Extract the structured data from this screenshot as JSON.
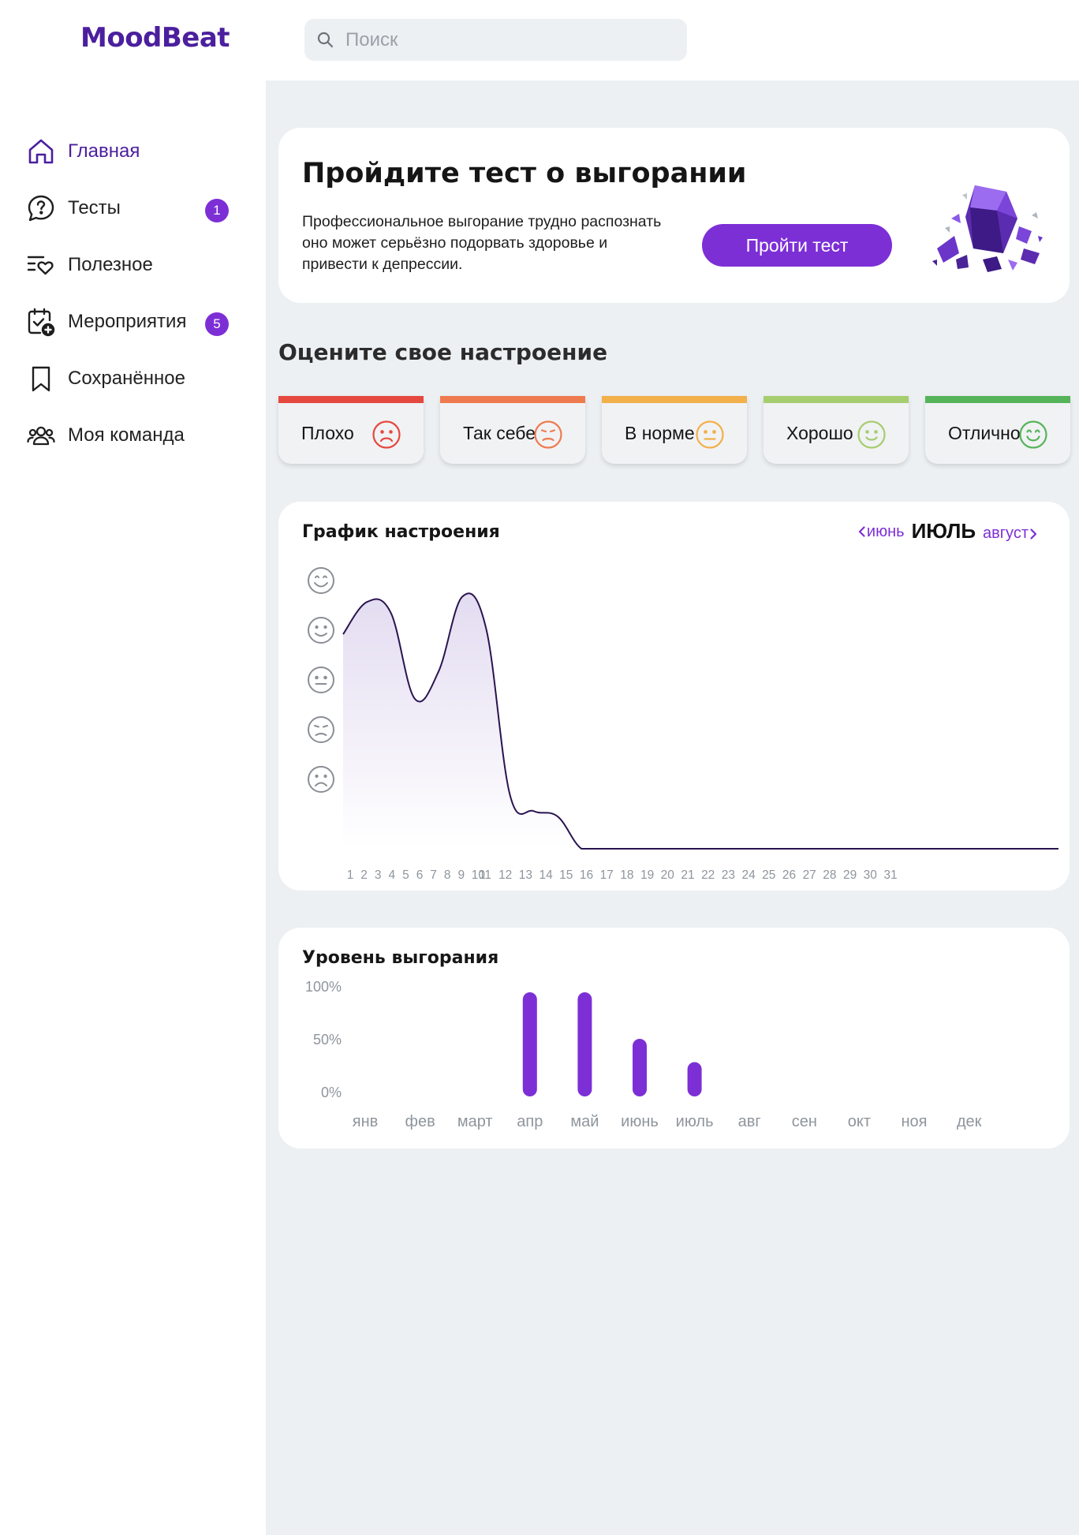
{
  "app": {
    "name": "MoodBeat"
  },
  "search": {
    "placeholder": "Поиск"
  },
  "sidebar": {
    "items": [
      {
        "label": "Главная",
        "icon": "home-icon",
        "active": true
      },
      {
        "label": "Тесты",
        "icon": "question-bubble-icon",
        "badge": "1"
      },
      {
        "label": "Полезное",
        "icon": "list-heart-icon"
      },
      {
        "label": "Мероприятия",
        "icon": "calendar-plus-icon",
        "badge": "5"
      },
      {
        "label": "Сохранённое",
        "icon": "bookmark-icon"
      },
      {
        "label": "Моя команда",
        "icon": "team-icon"
      }
    ]
  },
  "promo": {
    "title": "Пройдите тест о выгорании",
    "text": "Профессиональное выгорание трудно распознать оно может серьёзно подорвать здоровье и привести к депрессии.",
    "button": "Пройти тест"
  },
  "rate": {
    "title": "Оцените свое настроение",
    "moods": [
      {
        "label": "Плохо",
        "color": "#e5483f",
        "face": "sad"
      },
      {
        "label": "Так себе",
        "color": "#ee7b4f",
        "face": "meh-sad"
      },
      {
        "label": "В норме",
        "color": "#f2b04b",
        "face": "neutral"
      },
      {
        "label": "Хорошо",
        "color": "#a6cd6f",
        "face": "smile"
      },
      {
        "label": "Отлично",
        "color": "#55b45a",
        "face": "big-smile"
      }
    ]
  },
  "colors": {
    "accent": "#7d2fd6",
    "brand": "#4b1f9e",
    "background": "#ecf0f3"
  },
  "mood_chart": {
    "title": "График настроения",
    "prev_month": "июнь",
    "current_month": "ИЮЛЬ",
    "next_month": "август"
  },
  "burnout_chart": {
    "title": "Уровень выгорания"
  },
  "chart_data": [
    {
      "type": "area",
      "title": "График настроения",
      "x": [
        1,
        2,
        3,
        4,
        5,
        6,
        7,
        8,
        9,
        10,
        11,
        12,
        13,
        14,
        15,
        16,
        17,
        18,
        19,
        20,
        21,
        22,
        23,
        24,
        25,
        26,
        27,
        28,
        29,
        30,
        31
      ],
      "y_levels": [
        "sad",
        "meh-sad",
        "neutral",
        "smile",
        "big-smile"
      ],
      "ylim": [
        0,
        5
      ],
      "values": [
        4.0,
        4.6,
        4.4,
        2.8,
        3.3,
        4.7,
        4.1,
        1.0,
        0.7,
        0.6,
        0,
        0,
        0,
        0,
        0,
        0,
        0,
        0,
        0,
        0,
        0,
        0,
        0,
        0,
        0,
        0,
        0,
        0,
        0,
        0,
        0
      ],
      "grid": false
    },
    {
      "type": "bar",
      "title": "Уровень выгорания",
      "categories": [
        "янв",
        "фев",
        "март",
        "апр",
        "май",
        "июнь",
        "июль",
        "авг",
        "сен",
        "окт",
        "ноя",
        "дек"
      ],
      "values": [
        null,
        null,
        null,
        100,
        100,
        50,
        25,
        null,
        null,
        null,
        null,
        null
      ],
      "yticks": [
        "100%",
        "50%",
        "0%"
      ],
      "ylim": [
        0,
        100
      ],
      "grid": false
    }
  ]
}
